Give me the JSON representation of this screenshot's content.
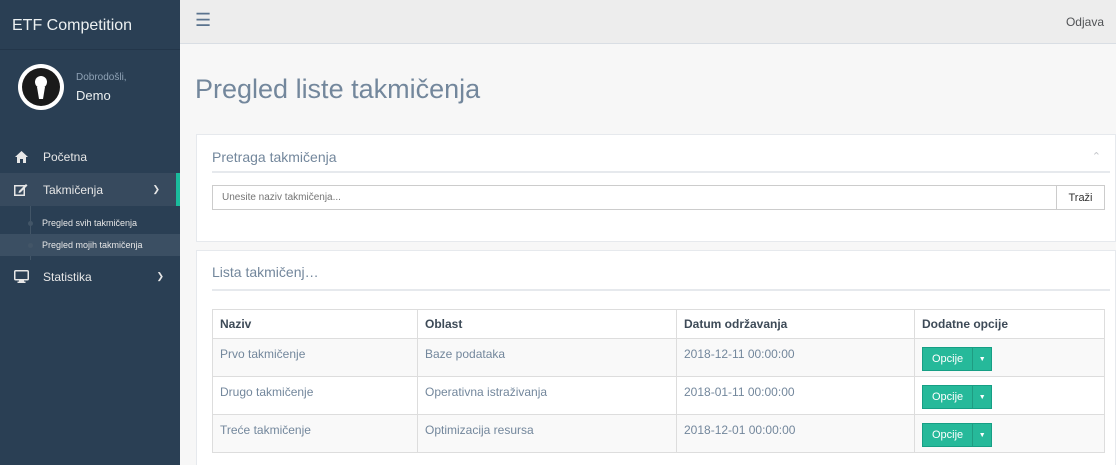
{
  "brand": {
    "title": "ETF Competition"
  },
  "profile": {
    "welcome": "Dobrodošli,",
    "name": "Demo"
  },
  "sidebar": {
    "items": [
      {
        "label": "Početna",
        "icon": "home-icon"
      },
      {
        "label": "Takmičenja",
        "icon": "edit-icon",
        "subitems": [
          {
            "label": "Pregled svih takmičenja"
          },
          {
            "label": "Pregled mojih takmičenja"
          }
        ]
      },
      {
        "label": "Statistika",
        "icon": "desktop-icon"
      }
    ]
  },
  "topnav": {
    "logout": "Odjava"
  },
  "page": {
    "title": "Pregled liste takmičenja"
  },
  "search": {
    "title": "Pretraga takmičenja",
    "placeholder": "Unesite naziv takmičenja...",
    "button": "Traži"
  },
  "list": {
    "title": "Lista takmičenj…",
    "headers": [
      "Naziv",
      "Oblast",
      "Datum održavanja",
      "Dodatne opcije"
    ],
    "rows": [
      {
        "naziv": "Prvo takmičenje",
        "oblast": "Baze podataka",
        "datum": "2018-12-11 00:00:00",
        "options": "Opcije"
      },
      {
        "naziv": "Drugo takmičenje",
        "oblast": "Operativna istraživanja",
        "datum": "2018-01-11 00:00:00",
        "options": "Opcije"
      },
      {
        "naziv": "Treće takmičenje",
        "oblast": "Optimizacija resursa",
        "datum": "2018-12-01 00:00:00",
        "options": "Opcije"
      }
    ]
  },
  "colors": {
    "sidebar": "#2a3f54",
    "accent": "#1abb9c",
    "button": "#26b99a"
  }
}
